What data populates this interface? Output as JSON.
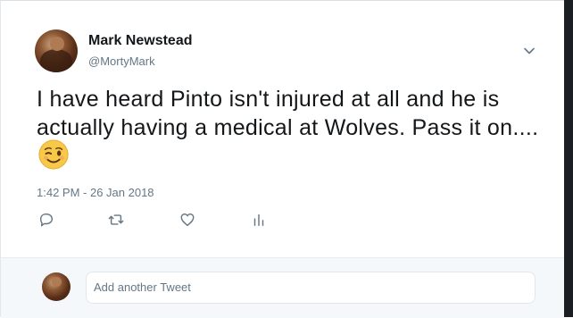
{
  "tweet": {
    "author_name": "Mark Newstead",
    "author_handle": "@MortyMark",
    "text": "I have heard Pinto isn't injured at all and he is actually having a medical at Wolves. Pass it on....",
    "emoji": "winking-face",
    "timestamp": "1:42 PM - 26 Jan 2018"
  },
  "actions": {
    "reply_icon": "reply-icon",
    "retweet_icon": "retweet-icon",
    "like_icon": "heart-icon",
    "analytics_icon": "analytics-icon"
  },
  "reply_box": {
    "placeholder": "Add another Tweet"
  },
  "colors": {
    "text": "#14171a",
    "secondary": "#657786",
    "footer_bg": "#f5f8fa",
    "icon": "#657786"
  }
}
